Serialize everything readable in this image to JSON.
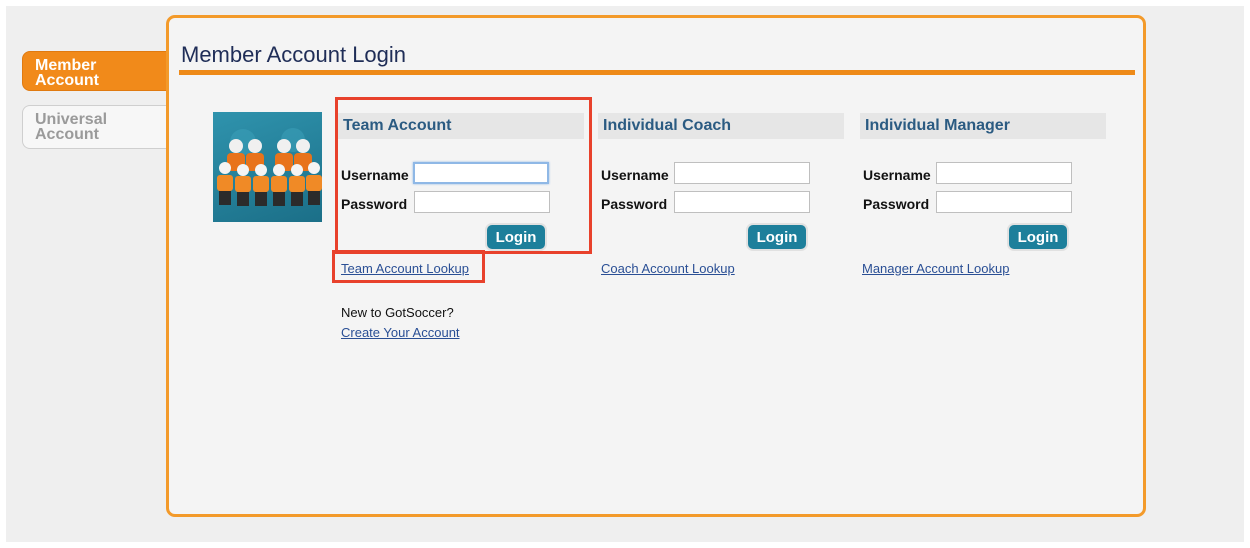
{
  "tabs": {
    "member": [
      "Member",
      "Account"
    ],
    "universal": [
      "Universal",
      "Account"
    ]
  },
  "page": {
    "title": "Member Account Login"
  },
  "sections": [
    {
      "heading": "Team Account",
      "username_label": "Username",
      "password_label": "Password",
      "username_value": "",
      "password_value": "",
      "login_label": "Login",
      "lookup_link": "Team Account Lookup"
    },
    {
      "heading": "Individual Coach",
      "username_label": "Username",
      "password_label": "Password",
      "username_value": "",
      "password_value": "",
      "login_label": "Login",
      "lookup_link": "Coach Account Lookup"
    },
    {
      "heading": "Individual Manager",
      "username_label": "Username",
      "password_label": "Password",
      "username_value": "",
      "password_value": "",
      "login_label": "Login",
      "lookup_link": "Manager Account Lookup"
    }
  ],
  "signup": {
    "prompt": "New to GotSoccer?",
    "link": "Create Your Account"
  },
  "colors": {
    "accent_orange": "#f18a1a",
    "button_teal": "#1d7f9b",
    "link_blue": "#2a4f95",
    "highlight_red": "#e8412b"
  }
}
